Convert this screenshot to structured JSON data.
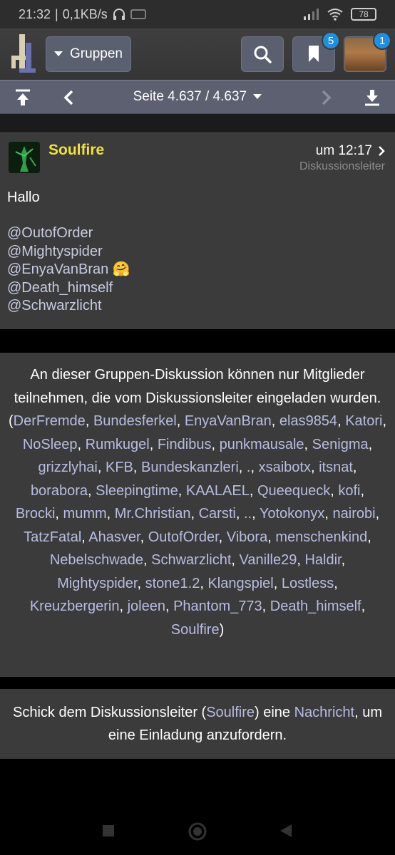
{
  "status": {
    "time": "21:32",
    "speed": "0,1KB/s",
    "battery": "78"
  },
  "topbar": {
    "groups_label": "Gruppen",
    "bookmark_badge": "5",
    "profile_badge": "1"
  },
  "pager": {
    "label": "Seite 4.637 / 4.637"
  },
  "post": {
    "author": "Soulfire",
    "time": "um 12:17",
    "role": "Diskussionsleiter",
    "text": "Hallo",
    "mentions": [
      "@OutofOrder",
      "@Mightyspider",
      "@EnyaVanBran 🤗",
      "@Death_himself",
      "@Schwarzlicht"
    ]
  },
  "notice": {
    "text": "An dieser Gruppen-Diskussion können nur Mitglieder teilnehmen, die vom Diskussionsleiter eingeladen wurden.",
    "members": [
      "DerFremde",
      "Bundesferkel",
      "EnyaVanBran",
      "elas9854",
      "Katori",
      "NoSleep",
      "Rumkugel",
      "Findibus",
      "punkmausale",
      "Senigma",
      "grizzlyhai",
      "KFB",
      "Bundeskanzleri",
      ".",
      "xsaibotx",
      "itsnat",
      "borabora",
      "Sleepingtime",
      "KAALAEL",
      "Queequeck",
      "kofi",
      "Brocki",
      "mumm",
      "Mr.Christian",
      "Carsti",
      "..",
      "Yotokonyx",
      "nairobi",
      "TatzFatal",
      "Ahasver",
      "OutofOrder",
      "Vibora",
      "menschenkind",
      "Nebelschwade",
      "Schwarzlicht",
      "Vanille29",
      "Haldir",
      "Mightyspider",
      "stone1.2",
      "Klangspiel",
      "Lostless",
      "Kreuzbergerin",
      "joleen",
      "Phantom_773",
      "Death_himself",
      "Soulfire"
    ]
  },
  "cta": {
    "prefix": "Schick dem Diskussionsleiter (",
    "leader": "Soulfire",
    "middle": ") eine ",
    "link": "Nachricht",
    "suffix": ", um eine Einladung anzufordern."
  },
  "colors": {
    "author": "#f2e23a",
    "link": "#b8bde0",
    "badge": "#1f8fe0"
  }
}
